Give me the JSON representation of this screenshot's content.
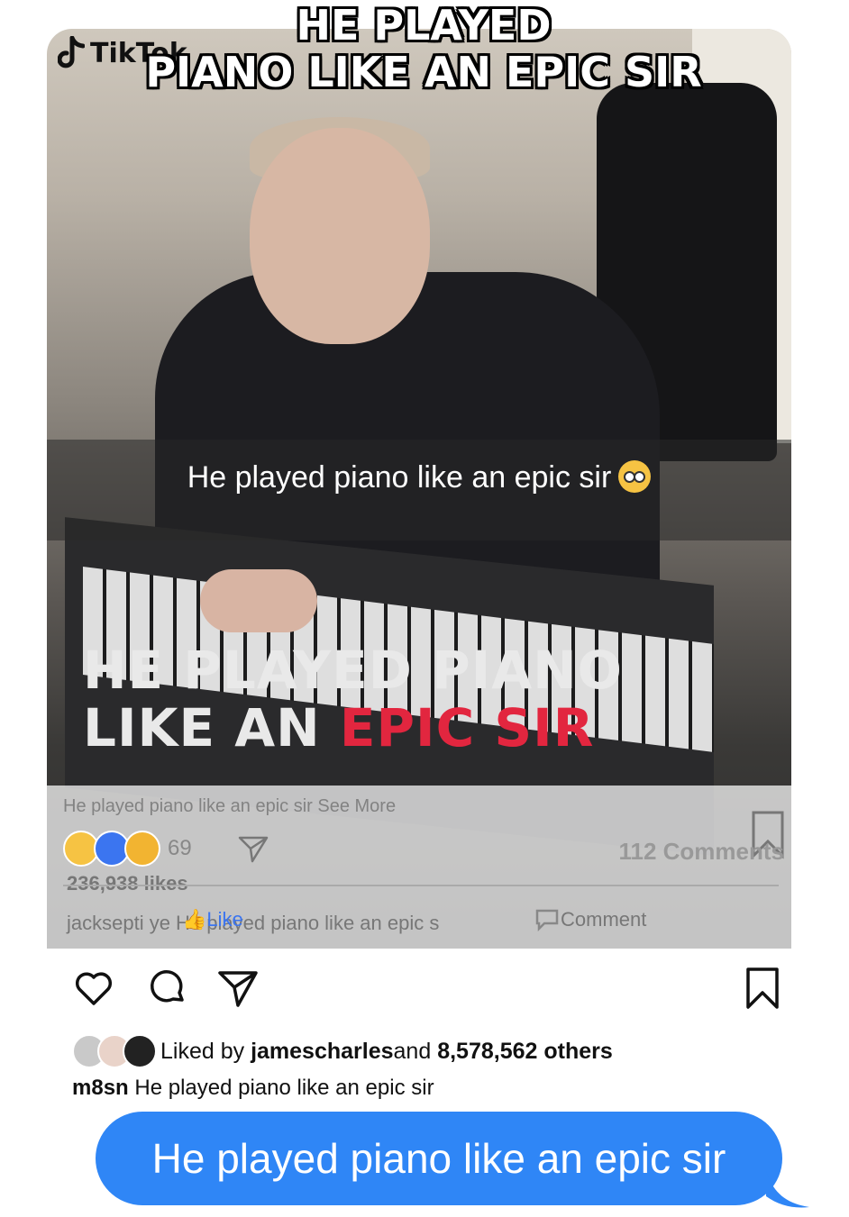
{
  "meme": {
    "title_line1": "HE PLAYED",
    "title_line2": "PIANO LIKE AN EPIC SIR"
  },
  "tiktok": {
    "logo_text": "TikTok"
  },
  "video": {
    "snap_caption": "He played piano like an epic sir",
    "snap_caption_emoji": "flushed-face",
    "overlay_title_line1": "HE PLAYED PIANO",
    "overlay_title_line2_white": "LIKE AN ",
    "overlay_title_line2_red": "EPIC SIR"
  },
  "facebook_overlay": {
    "post_caption": "He played piano like an epic sir See More",
    "reaction_count": "69",
    "comments": "112 Comments",
    "likes": "236,938 likes",
    "comment_preview": "jacksepti  ye He played piano like an epic s",
    "like_button": "Like",
    "comment_button": "Comment"
  },
  "instagram": {
    "liked_by_prefix": "Liked by ",
    "liked_by_user": "jamescharles",
    "liked_by_middle": " and ",
    "liked_by_others": "8,578,562 others",
    "caption_user": "m8sn",
    "caption_text": " He played piano like an epic sir"
  },
  "message": {
    "text": "He played piano like an epic sir",
    "bubble_color": "#2f86f6"
  },
  "colors": {
    "epic_red": "#e2263f",
    "fb_blue": "#3b75f0"
  }
}
